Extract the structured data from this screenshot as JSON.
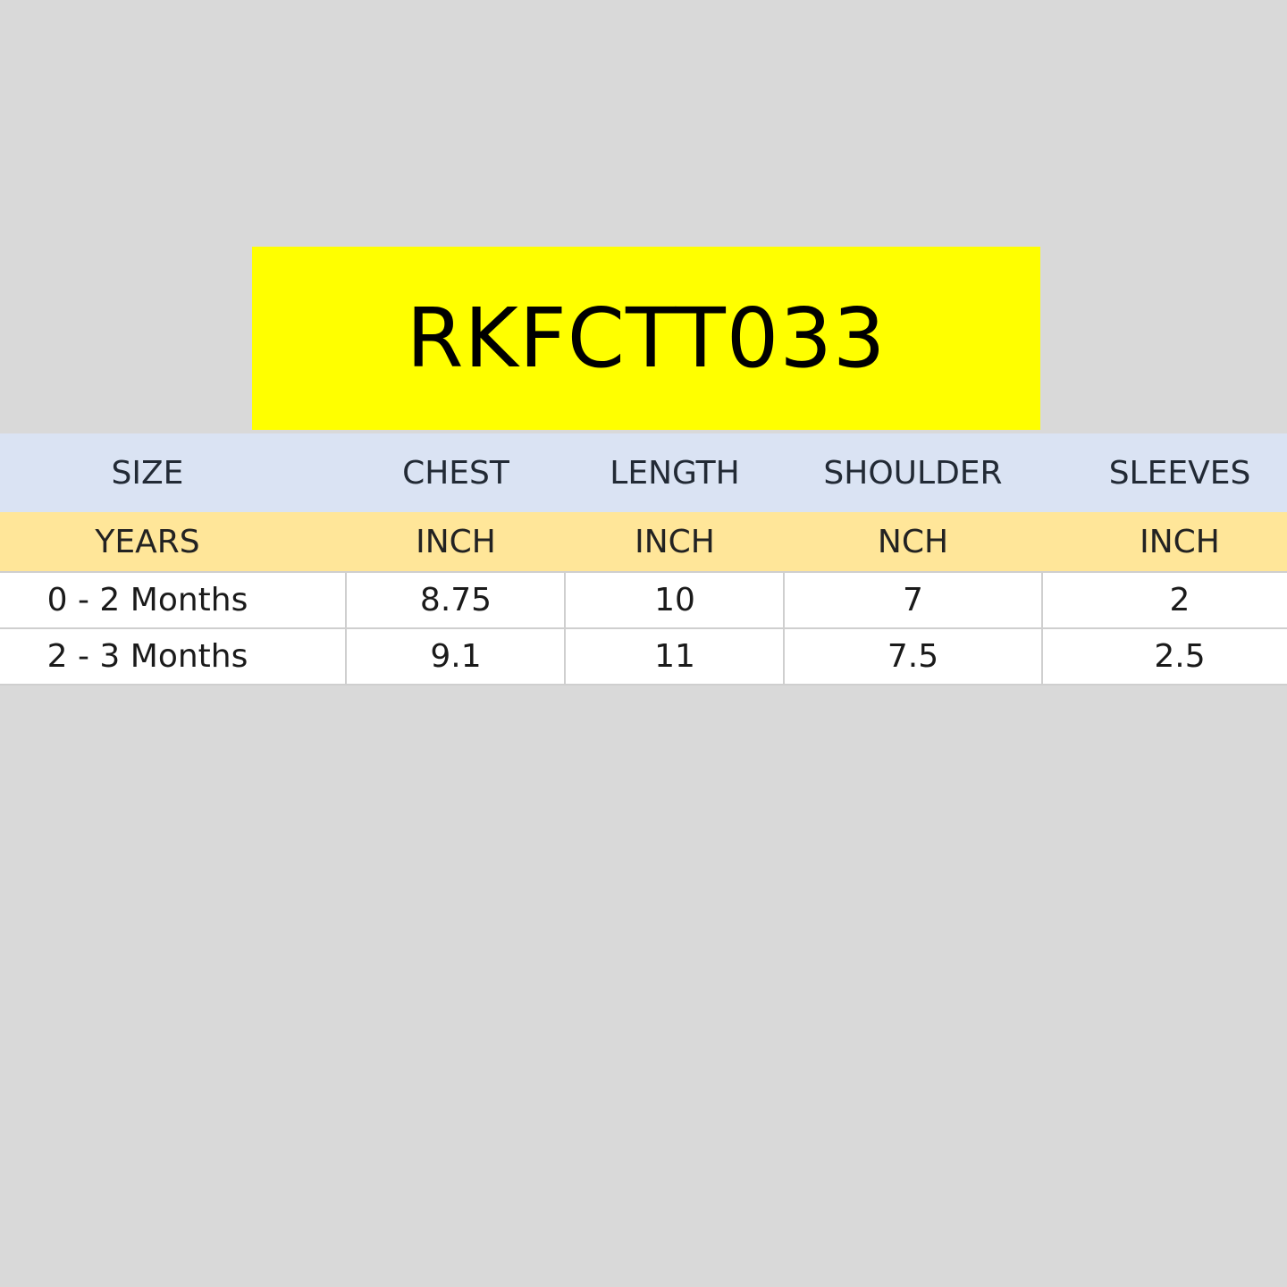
{
  "banner": {
    "code": "RKFCTT033",
    "color": "#ffff00"
  },
  "table": {
    "header": [
      "SIZE",
      "CHEST",
      "LENGTH",
      "SHOULDER",
      "SLEEVES"
    ],
    "units": [
      "YEARS",
      "INCH",
      "INCH",
      "NCH",
      "INCH"
    ],
    "rows": [
      [
        "0 - 2 Months",
        "8.75",
        "10",
        "7",
        "2"
      ],
      [
        "2 - 3 Months",
        "9.1",
        "11",
        "7.5",
        "2.5"
      ]
    ],
    "colors": {
      "header_bg": "#dae3f3",
      "units_bg": "#ffe699",
      "data_bg": "#ffffff",
      "page_bg": "#d9d9d9"
    }
  }
}
